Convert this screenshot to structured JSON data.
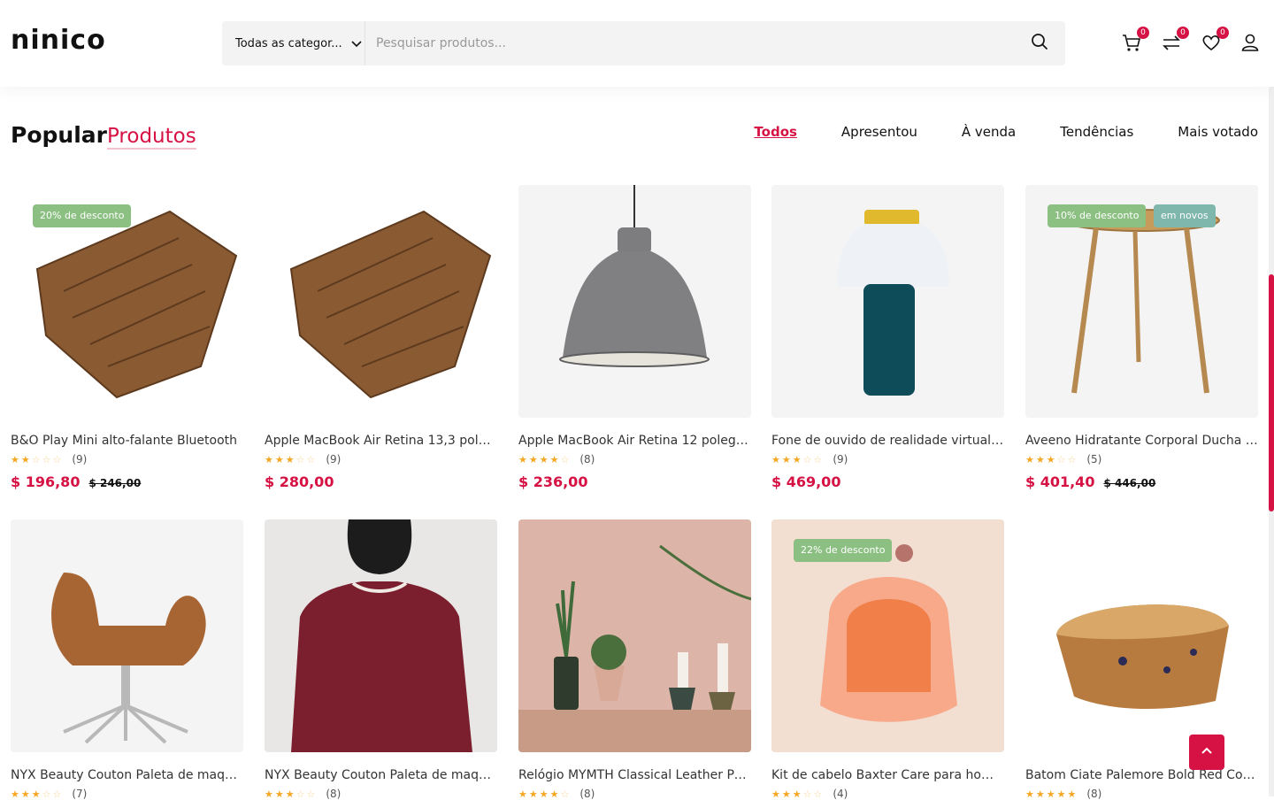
{
  "header": {
    "logo": "ninico",
    "category_label": "Todas as categor...",
    "search_placeholder": "Pesquisar produtos...",
    "cart_count": "0",
    "compare_count": "0",
    "wishlist_count": "0"
  },
  "section": {
    "title_main": "Popular",
    "title_accent": "Produtos",
    "tabs": [
      "Todos",
      "Apresentou",
      "À venda",
      "Tendências",
      "Mais votado"
    ],
    "active_tab": "Todos"
  },
  "products": [
    {
      "title": "B&O Play Mini alto-falante Bluetooth",
      "reviews": "(9)",
      "stars": 2,
      "price": "$ 196,80",
      "old_price": "$ 246,00",
      "tags": [
        "20% de desconto"
      ],
      "image": "bread-slices-icon"
    },
    {
      "title": "Apple MacBook Air Retina 13,3 poleg...",
      "reviews": "(9)",
      "stars": 3,
      "price": "$ 280,00",
      "old_price": "",
      "tags": [],
      "image": "bread-slices-icon"
    },
    {
      "title": "Apple MacBook Air Retina 12 polegad...",
      "reviews": "(8)",
      "stars": 4,
      "price": "$ 236,00",
      "old_price": "",
      "tags": [],
      "image": "pendant-lamp-icon"
    },
    {
      "title": "Fone de ouvido de realidade virtual S...",
      "reviews": "(9)",
      "stars": 3,
      "price": "$ 469,00",
      "old_price": "",
      "tags": [],
      "image": "table-lamp-icon"
    },
    {
      "title": "Aveeno Hidratante Corporal Ducha 45...",
      "reviews": "(5)",
      "stars": 3,
      "price": "$ 401,40",
      "old_price": "$ 446,00",
      "tags": [
        "10% de desconto",
        "em novos"
      ],
      "image": "side-table-icon"
    },
    {
      "title": "NYX Beauty Couton Paleta de maquia...",
      "reviews": "(7)",
      "stars": 3,
      "price": "",
      "old_price": "",
      "tags": [],
      "image": "lounge-chair-icon"
    },
    {
      "title": "NYX Beauty Couton Paleta de maquia...",
      "reviews": "(8)",
      "stars": 3,
      "price": "",
      "old_price": "",
      "tags": [],
      "image": "sweater-icon"
    },
    {
      "title": "Relógio MYMTH Classical Leather Preto",
      "reviews": "(8)",
      "stars": 4,
      "price": "",
      "old_price": "",
      "tags": [],
      "image": "shelf-decor-icon"
    },
    {
      "title": "Kit de cabelo Baxter Care para homen...",
      "reviews": "(4)",
      "stars": 3,
      "price": "",
      "old_price": "",
      "tags": [
        "22% de desconto"
      ],
      "image": "pet-carrier-icon"
    },
    {
      "title": "Batom Ciate Palemore Bold Red Color",
      "reviews": "(8)",
      "stars": 5,
      "price": "",
      "old_price": "",
      "tags": [],
      "image": "crumb-cake-icon"
    }
  ],
  "colors": {
    "accent": "#d51243",
    "tag_green": "#8cc083",
    "tag_teal": "#7fb7ad",
    "star": "#f5a623"
  }
}
